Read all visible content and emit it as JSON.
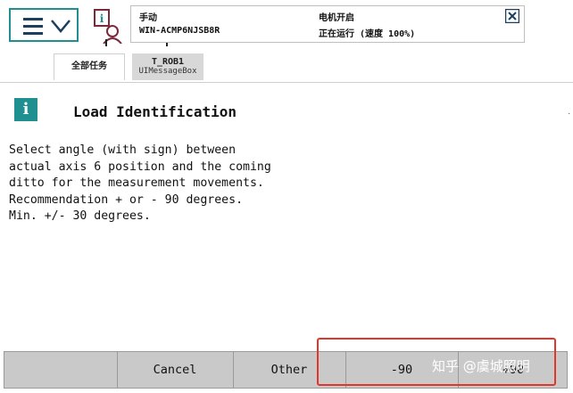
{
  "status": {
    "mode": "手动",
    "controller": "WIN-ACMP6NJSB8R",
    "motors": "电机开启",
    "run_state": "正在运行 (速度 100%)"
  },
  "tabs": [
    {
      "label": "全部任务"
    },
    {
      "label": "T_ROB1",
      "sublabel": "UIMessageBox"
    }
  ],
  "message": {
    "title": "Load Identification",
    "lines": [
      "Select angle (with sign) between",
      "actual axis 6 position and the coming",
      "ditto for the measurement movements.",
      "Recommendation + or - 90 degrees.",
      "Min. +/- 30 degrees."
    ]
  },
  "buttons": {
    "cancel": "Cancel",
    "other": "Other",
    "minus90": "-90",
    "plus90": "+90"
  },
  "watermark": "知乎 @虞城照明",
  "colors": {
    "accent": "#1f8f8f",
    "highlight": "#e2362b",
    "button_bar": "#c9c9c9"
  },
  "icons": [
    "menu-icon",
    "chevron-down-icon",
    "quickset-icon",
    "close-icon",
    "info-icon"
  ]
}
